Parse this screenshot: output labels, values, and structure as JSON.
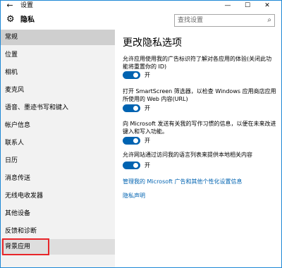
{
  "window": {
    "back": "←",
    "title": "设置",
    "minimize": "—",
    "maximize": "☐",
    "close": "✕"
  },
  "header": {
    "app_title": "隐私",
    "search_placeholder": "查找设置"
  },
  "sidebar": {
    "items": [
      {
        "label": "常规"
      },
      {
        "label": "位置"
      },
      {
        "label": "相机"
      },
      {
        "label": "麦克风"
      },
      {
        "label": "语音、墨迹书写和键入"
      },
      {
        "label": "帐户信息"
      },
      {
        "label": "联系人"
      },
      {
        "label": "日历"
      },
      {
        "label": "消息传送"
      },
      {
        "label": "无线电收发器"
      },
      {
        "label": "其他设备"
      },
      {
        "label": "反馈和诊断"
      },
      {
        "label": "背景应用"
      }
    ],
    "active_index": 0,
    "selected_index": 12
  },
  "main": {
    "heading": "更改隐私选项",
    "options": [
      {
        "text": "允许应用使用我的广告标识符了解对各应用的体验(关闭此功能将重置你的 ID)",
        "state": "开",
        "on": true
      },
      {
        "text": "打开 SmartScreen 筛选器，以检查 Windows 应用商店应用所使用的 Web 内容(URL)",
        "state": "开",
        "on": true
      },
      {
        "text": "向 Microsoft 发送有关我的写作习惯的信息，以便在未来改进键入和写入功能。",
        "state": "开",
        "on": true
      },
      {
        "text": "允许网站通过访问我的语言列表来提供本地相关内容",
        "state": "开",
        "on": true
      }
    ],
    "link_ads": "管理我的 Microsoft 广告和其他个性化设置信息",
    "link_privacy": "隐私声明"
  },
  "colors": {
    "accent": "#0063b1",
    "sidebar_bg": "#f2f2f2",
    "highlight_box": "#e8262a"
  }
}
